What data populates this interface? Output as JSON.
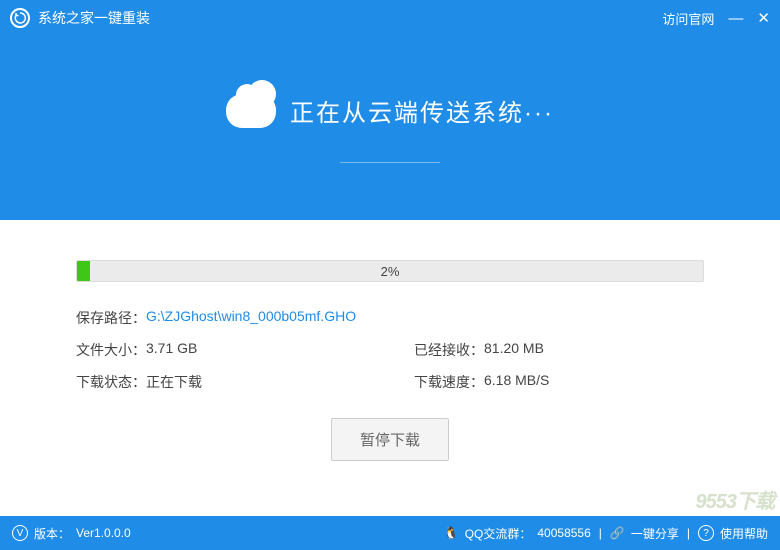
{
  "titlebar": {
    "title": "系统之家一键重装",
    "visit_link": "访问官网"
  },
  "banner": {
    "title": "正在从云端传送系统···"
  },
  "progress": {
    "percent_text": "2%",
    "percent_value": 2
  },
  "info": {
    "save_path_label": "保存路径：",
    "save_path_value": "G:\\ZJGhost\\win8_000b05mf.GHO",
    "file_size_label": "文件大小：",
    "file_size_value": "3.71 GB",
    "received_label": "已经接收：",
    "received_value": "81.20 MB",
    "status_label": "下载状态：",
    "status_value": "正在下载",
    "speed_label": "下载速度：",
    "speed_value": "6.18 MB/S"
  },
  "buttons": {
    "pause": "暂停下载"
  },
  "footer": {
    "version_label": "版本：",
    "version_value": "Ver1.0.0.0",
    "qq_label": "QQ交流群：",
    "qq_value": "40058556",
    "share": "一键分享",
    "help": "使用帮助"
  },
  "watermark": "9553下载"
}
